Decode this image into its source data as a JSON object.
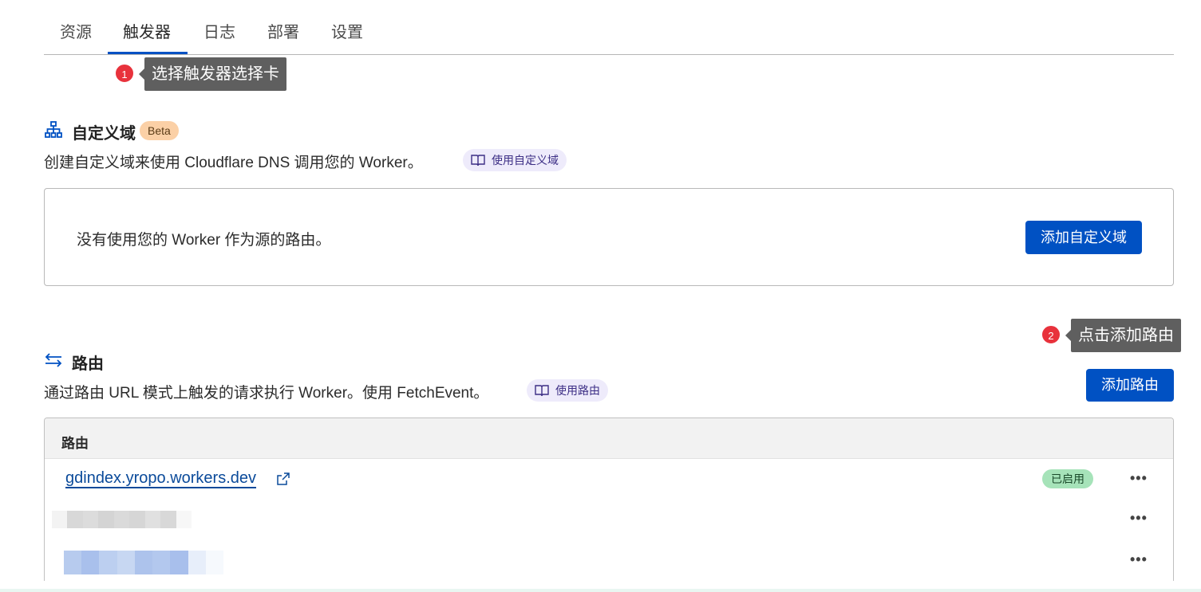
{
  "tabs": [
    {
      "label": "资源"
    },
    {
      "label": "触发器"
    },
    {
      "label": "日志"
    },
    {
      "label": "部署"
    },
    {
      "label": "设置"
    }
  ],
  "active_tab": "触发器",
  "tooltips": [
    {
      "step": "1",
      "text": "选择触发器选择卡"
    },
    {
      "step": "2",
      "text": "点击添加路由"
    }
  ],
  "custom_domain": {
    "title": "自定义域",
    "badge": "Beta",
    "description": "创建自定义域来使用 Cloudflare DNS 调用您的 Worker。",
    "doc_link": "使用自定义域",
    "empty_text": "没有使用您的 Worker 作为源的路由。",
    "add_button": "添加自定义域"
  },
  "routes": {
    "title": "路由",
    "description": "通过路由 URL 模式上触发的请求执行 Worker。使用 FetchEvent。",
    "doc_link": "使用路由",
    "add_button": "添加路由",
    "table_header": "路由",
    "rows": [
      {
        "route": "gdindex.yropo.workers.dev",
        "status": "已启用",
        "menu": "•••"
      },
      {
        "route": "",
        "status": "",
        "menu": "•••"
      },
      {
        "route": "",
        "status": "",
        "menu": "•••"
      }
    ]
  },
  "colors": {
    "accent": "#0051c3",
    "tooltip_bg": "#5f5f5f",
    "step_dot": "#e8323c",
    "beta_badge": "#fbd0a6",
    "enabled_badge": "#a6e3b9"
  }
}
